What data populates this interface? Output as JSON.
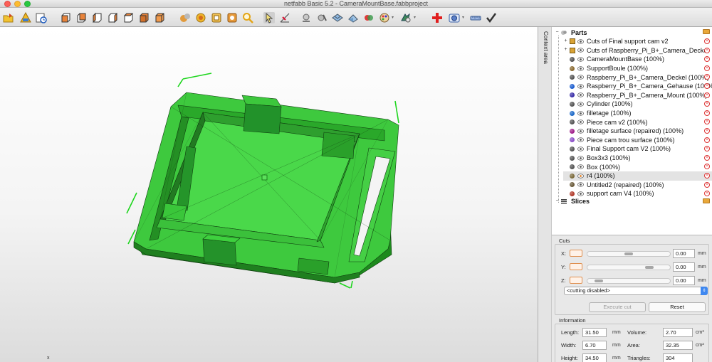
{
  "window": {
    "title": "netfabb Basic 5.2 - CameraMountBase.fabbproject"
  },
  "toolbar": {
    "icons": [
      "open-icon",
      "repair-icon",
      "history-icon",
      "view-front-icon",
      "view-back-icon",
      "view-left-icon",
      "view-right-icon",
      "view-top-icon",
      "view-bottom-icon",
      "shaded-icon",
      "textured-icon",
      "wireframe-icon",
      "wire-shaded-icon",
      "zoom-icon",
      "select-icon",
      "measure-icon",
      "part-analysis-icon",
      "slice-icon",
      "nesting-icon",
      "fit-view-icon",
      "colors-icon",
      "palette-icon",
      "settings-icon",
      "add-part-icon",
      "camera-icon",
      "ruler-icon",
      "check-icon"
    ]
  },
  "viewport": {
    "axis_x": "x"
  },
  "context": {
    "label": "Context area"
  },
  "tree": {
    "root_label": "Parts",
    "items": [
      {
        "label": "Cuts of Final support cam v2",
        "color": "#d9a336",
        "kind": "group"
      },
      {
        "label": "Cuts of Raspberry_Pi_B+_Camera_Deckel",
        "color": "#d9a336",
        "kind": "group"
      },
      {
        "label": "CameraMountBase (100%)",
        "color": "#555555",
        "kind": "part"
      },
      {
        "label": "SupportBoule (100%)",
        "color": "#8a6a30",
        "kind": "part"
      },
      {
        "label": "Raspberry_Pi_B+_Camera_Deckel (100%)",
        "color": "#555555",
        "kind": "part"
      },
      {
        "label": "Raspberry_Pi_B+_Camera_Gehause (100%)",
        "color": "#1e5fd0",
        "kind": "part"
      },
      {
        "label": "Raspberry_Pi_B+_Camera_Mount (100%)",
        "color": "#3b2fa8",
        "kind": "part"
      },
      {
        "label": "Cylinder (100%)",
        "color": "#555555",
        "kind": "part"
      },
      {
        "label": "filletage (100%)",
        "color": "#1e6ac8",
        "kind": "part"
      },
      {
        "label": "Piece cam v2 (100%)",
        "color": "#555555",
        "kind": "part"
      },
      {
        "label": "filletage surface (repaired) (100%)",
        "color": "#a01e8a",
        "kind": "part"
      },
      {
        "label": "Piece cam trou surface (100%)",
        "color": "#8b4fc8",
        "kind": "part"
      },
      {
        "label": "Final Support cam V2 (100%)",
        "color": "#555555",
        "kind": "part"
      },
      {
        "label": "Box3x3 (100%)",
        "color": "#555555",
        "kind": "part"
      },
      {
        "label": "Box (100%)",
        "color": "#555555",
        "kind": "part"
      },
      {
        "label": "r4 (100%)",
        "color": "#7b6a3a",
        "kind": "selected"
      },
      {
        "label": "Untitled2 (repaired) (100%)",
        "color": "#6a5a3a",
        "kind": "part"
      },
      {
        "label": "support cam V4 (100%)",
        "color": "#b03a2a",
        "kind": "part"
      }
    ],
    "slices_label": "Slices"
  },
  "cuts": {
    "title": "Cuts",
    "x_label": "X:",
    "y_label": "Y:",
    "z_label": "Z:",
    "x_value": "0.00",
    "y_value": "0.00",
    "z_value": "0.00",
    "unit": "mm",
    "x_slider": 0.5,
    "y_slider": 0.78,
    "z_slider": 0.1,
    "mode": "<cutting disabled>",
    "execute_label": "Execute cut",
    "reset_label": "Reset"
  },
  "info": {
    "title": "Information",
    "length_label": "Length:",
    "length_value": "31.50",
    "width_label": "Width:",
    "width_value": "6.70",
    "height_label": "Height:",
    "height_value": "34.50",
    "unit_mm": "mm",
    "volume_label": "Volume:",
    "volume_value": "2.70",
    "volume_unit": "cm³",
    "area_label": "Area:",
    "area_value": "32.35",
    "area_unit": "cm²",
    "triangles_label": "Triangles:",
    "triangles_value": "304"
  }
}
